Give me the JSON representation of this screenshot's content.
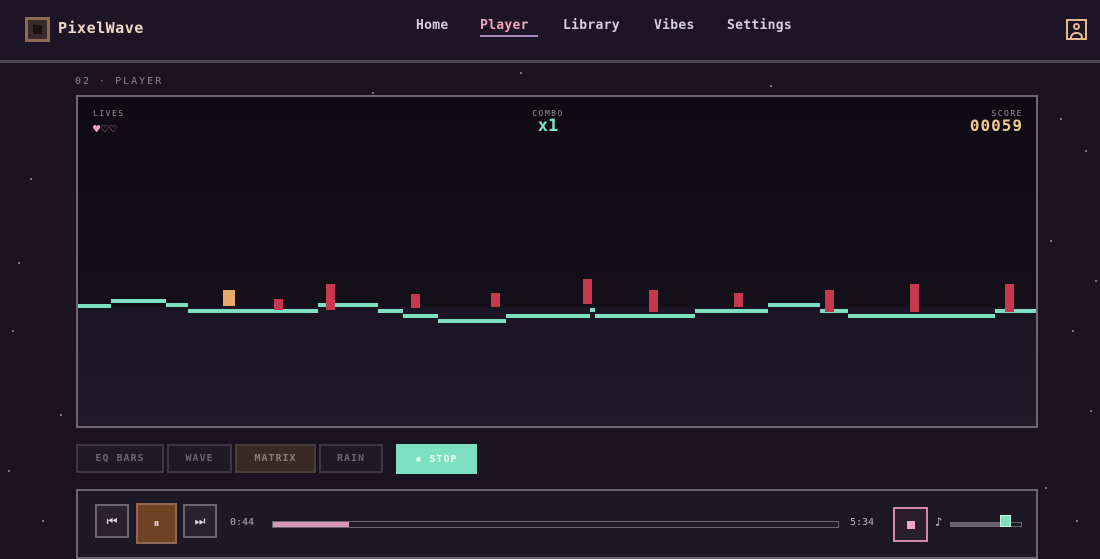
{
  "app": {
    "brand": "PixelWave",
    "nav": [
      {
        "label": "Home",
        "active": false
      },
      {
        "label": "Player",
        "active": true
      },
      {
        "label": "Library",
        "active": false
      },
      {
        "label": "Vibes",
        "active": false
      },
      {
        "label": "Settings",
        "active": false
      }
    ]
  },
  "section": {
    "label": "02 · PLAYER"
  },
  "game": {
    "lives_label": "LIVES",
    "lives": "♥♡♡",
    "combo_label": "COMBO",
    "combo": "x1",
    "score_label": "SCORE",
    "score": "00059"
  },
  "modes": {
    "eq_bars": "EQ BARS",
    "wave": "WAVE",
    "matrix": "MATRIX",
    "rain": "RAIN",
    "active": "MATRIX",
    "stop": "▪ STOP"
  },
  "player": {
    "elapsed": "0:44",
    "duration": "5:34",
    "progress": 0.135,
    "volume": 0.78,
    "prev_icon": "⏮",
    "pause_icon": "⏸",
    "next_icon": "⏭",
    "note_icon": "♪"
  },
  "colors": {
    "accent_pink": "#f2a6c0",
    "accent_mint": "#7de0c0",
    "score_gold": "#f3c98e",
    "obstacle_red": "#c8374e"
  }
}
